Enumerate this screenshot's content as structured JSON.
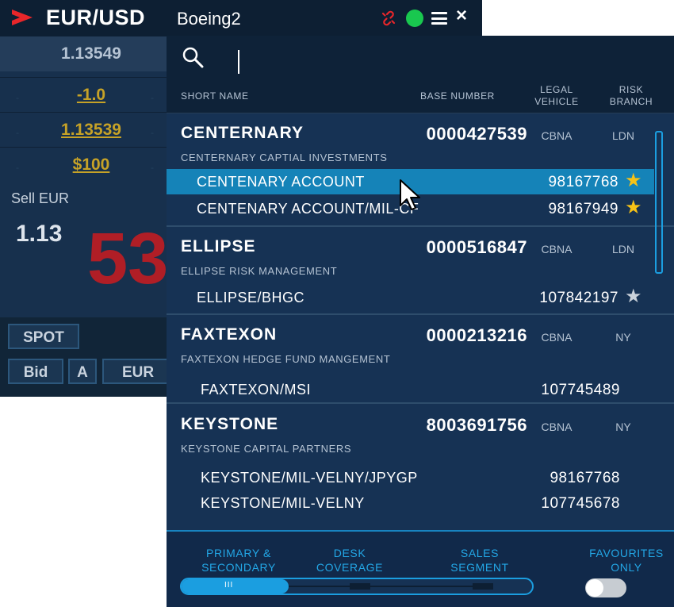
{
  "tile": {
    "arrow_icon": "chevron-right-icon",
    "pair": "EUR/USD",
    "bid_rate": "1.13549",
    "change": "-1.0",
    "rate_link": "1.13539",
    "amount": "$100",
    "sell_label": "Sell EUR",
    "rate_short": "1.13",
    "rate_big": "53",
    "spot_label": "SPOT",
    "bid_label": "Bid",
    "a_label": "A",
    "currency_label": "EUR"
  },
  "popup": {
    "title": "Boeing2",
    "icons": [
      "unlink-icon",
      "status-dot",
      "menu-icon",
      "close-icon"
    ],
    "status_color": "#19c84f",
    "close_symbol": "×",
    "search": {
      "value": "",
      "placeholder": ""
    }
  },
  "columns": {
    "short_name": "SHORT NAME",
    "base_number": "BASE NUMBER",
    "legal_vehicle_1": "LEGAL",
    "legal_vehicle_2": "VEHICLE",
    "risk_branch_1": "RISK",
    "risk_branch_2": "BRANCH"
  },
  "groups": [
    {
      "short_name": "CENTERNARY",
      "base_number": "0000427539",
      "legal_vehicle": "CBNA",
      "risk_branch": "LDN",
      "full_name": "CENTERNARY CAPTIAL INVESTMENTS",
      "accounts": [
        {
          "name": "CENTENARY ACCOUNT",
          "number": "98167768",
          "favourite": true,
          "selected": true
        },
        {
          "name": "CENTENARY ACCOUNT/MIL-CF",
          "number": "98167949",
          "favourite": true,
          "selected": false
        }
      ]
    },
    {
      "short_name": "ELLIPSE",
      "base_number": "0000516847",
      "legal_vehicle": "CBNA",
      "risk_branch": "LDN",
      "full_name": "ELLIPSE RISK MANAGEMENT",
      "accounts": [
        {
          "name": "ELLIPSE/BHGC",
          "number": "107842197",
          "favourite": false,
          "selected": false
        }
      ]
    },
    {
      "short_name": "FAXTEXON",
      "base_number": "0000213216",
      "legal_vehicle": "CBNA",
      "risk_branch": "NY",
      "full_name": "FAXTEXON HEDGE FUND MANGEMENT",
      "accounts": [
        {
          "name": "FAXTEXON/MSI",
          "number": "107745489"
        }
      ]
    },
    {
      "short_name": "KEYSTONE",
      "base_number": "8003691756",
      "legal_vehicle": "CBNA",
      "risk_branch": "NY",
      "full_name": "KEYSTONE CAPITAL PARTNERS",
      "accounts": [
        {
          "name": "KEYSTONE/MIL-VELNY/JPYGP",
          "number": "98167768"
        },
        {
          "name": "KEYSTONE/MIL-VELNY",
          "number": "107745678"
        }
      ]
    }
  ],
  "star_symbol": "★",
  "footer": {
    "primary_1": "PRIMARY &",
    "primary_2": "SECONDARY",
    "desk_1": "DESK",
    "desk_2": "COVERAGE",
    "sales_1": "SALES",
    "sales_2": "SEGMENT",
    "fav_1": "FAVOURITES",
    "fav_2": "ONLY",
    "slider_handle": "III",
    "slider_level": 0,
    "favourites_only": false
  },
  "colors": {
    "accent": "#1b9ee0",
    "selected_row": "#1583b8",
    "star_on": "#f6c217",
    "star_off": "#c9d1da",
    "brand_red": "#e8262a"
  }
}
